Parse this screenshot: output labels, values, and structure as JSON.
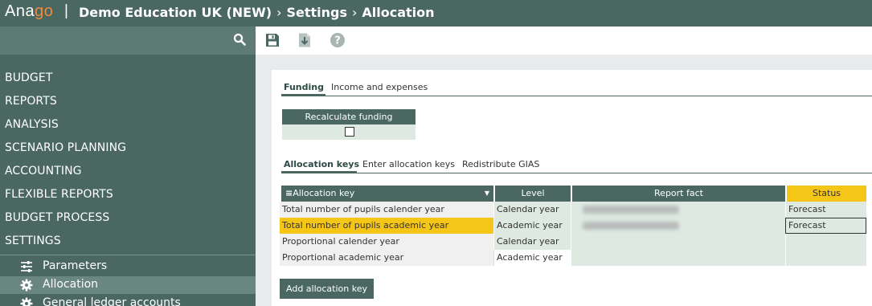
{
  "logo": {
    "part1": "Ana",
    "part2": "go"
  },
  "breadcrumb": {
    "separator": "|",
    "items": [
      "Demo Education UK (NEW)",
      "Settings",
      "Allocation"
    ],
    "arrow": "›"
  },
  "sidebar": {
    "menu": [
      "BUDGET",
      "REPORTS",
      "ANALYSIS",
      "SCENARIO PLANNING",
      "ACCOUNTING",
      "FLEXIBLE REPORTS",
      "BUDGET PROCESS",
      "SETTINGS"
    ],
    "sub_items": [
      {
        "label": "Parameters",
        "icon": "sliders-icon",
        "active": false
      },
      {
        "label": "Allocation",
        "icon": "gear-icon",
        "active": true
      },
      {
        "label": "General ledger accounts",
        "icon": "gear-icon",
        "active": false
      }
    ]
  },
  "toolbar": {
    "icons": [
      "save-icon",
      "download-icon",
      "help-icon"
    ]
  },
  "main": {
    "tabs_top": [
      {
        "label": "Funding",
        "active": true
      },
      {
        "label": "Income and expenses",
        "active": false
      }
    ],
    "recalculate": {
      "label": "Recalculate funding",
      "checked": false
    },
    "tabs_alloc": [
      {
        "label": "Allocation keys",
        "active": true
      },
      {
        "label": "Enter allocation keys",
        "active": false
      },
      {
        "label": "Redistribute GIAS",
        "active": false
      }
    ],
    "table": {
      "menu_glyph": "≡",
      "headers": [
        "Allocation key",
        "Level",
        "Report fact",
        "Status"
      ],
      "rows": [
        {
          "key": "Total number of pupils calender year",
          "level": "Calendar year",
          "status": "Forecast",
          "highlight": false
        },
        {
          "key": "Total number of pupils academic year",
          "level": "Academic year",
          "status": "Forecast",
          "highlight": true
        },
        {
          "key": "Proportional calender year",
          "level": "Calendar year",
          "status": "",
          "highlight": false
        },
        {
          "key": "Proportional academic year",
          "level": "Academic year",
          "status": "",
          "highlight": false
        }
      ]
    },
    "add_button": "Add allocation key"
  },
  "colors": {
    "brand": "#4a6861",
    "accent": "#f08a3a",
    "highlight": "#f5c518",
    "cell_green": "#dde9e1"
  }
}
